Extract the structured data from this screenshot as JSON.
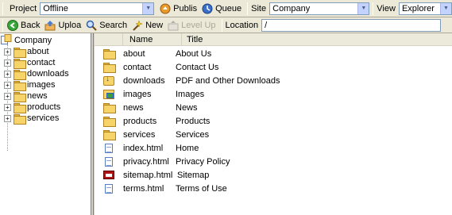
{
  "topbar": {
    "project_label": "Project",
    "project_value": "Offline",
    "publish_label": "Publis",
    "queue_label": "Queue",
    "site_label": "Site",
    "site_value": "Company",
    "view_label": "View",
    "view_value": "Explorer"
  },
  "toolbar": {
    "back_label": "Back",
    "upload_label": "Uploa",
    "search_label": "Search",
    "new_label": "New",
    "levelup_label": "Level Up",
    "location_label": "Location",
    "location_value": "/"
  },
  "tree": {
    "root": "Company",
    "items": [
      "about",
      "contact",
      "downloads",
      "images",
      "news",
      "products",
      "services"
    ]
  },
  "list": {
    "columns": [
      "Name",
      "Title"
    ],
    "rows": [
      {
        "icon": "folder-icon",
        "name": "about",
        "title": "About Us"
      },
      {
        "icon": "folder-icon",
        "name": "contact",
        "title": "Contact Us"
      },
      {
        "icon": "downloads-folder-icon",
        "name": "downloads",
        "title": "PDF and Other Downloads"
      },
      {
        "icon": "images-folder-icon",
        "name": "images",
        "title": "Images"
      },
      {
        "icon": "folder-icon",
        "name": "news",
        "title": "News"
      },
      {
        "icon": "folder-icon",
        "name": "products",
        "title": "Products"
      },
      {
        "icon": "folder-icon",
        "name": "services",
        "title": "Services"
      },
      {
        "icon": "page-icon",
        "name": "index.html",
        "title": "Home"
      },
      {
        "icon": "page-icon",
        "name": "privacy.html",
        "title": "Privacy Policy"
      },
      {
        "icon": "sitemap-icon",
        "name": "sitemap.html",
        "title": "Sitemap"
      },
      {
        "icon": "page-icon",
        "name": "terms.html",
        "title": "Terms of Use"
      }
    ]
  }
}
